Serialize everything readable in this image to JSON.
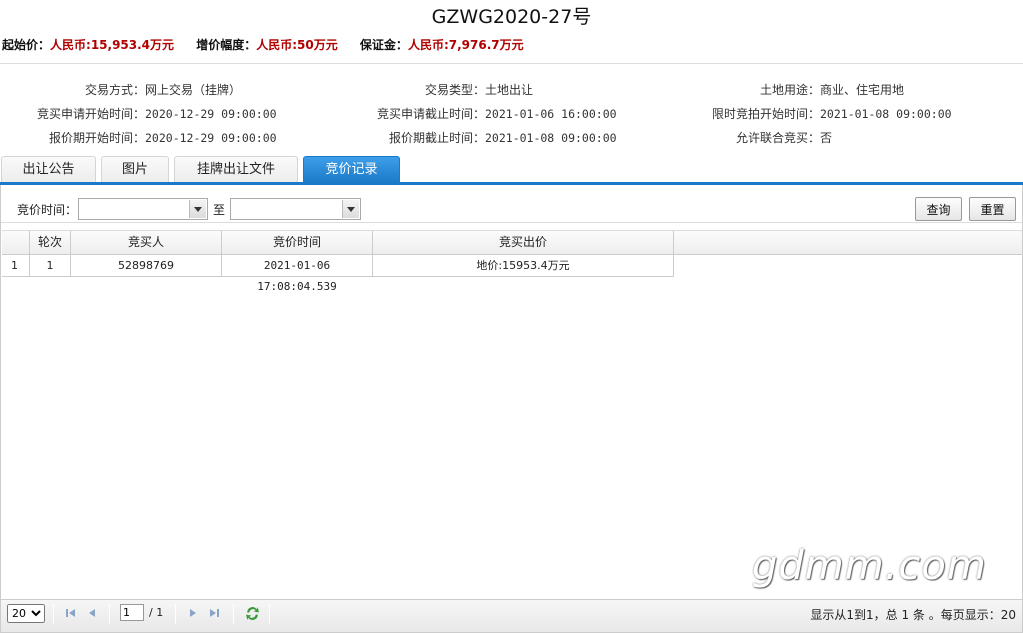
{
  "title": "GZWG2020-27号",
  "prices": {
    "start_label": "起始价：",
    "start_value": "人民币:15,953.4万元",
    "step_label": "增价幅度：",
    "step_value": "人民币:50万元",
    "deposit_label": "保证金：",
    "deposit_value": "人民币:7,976.7万元"
  },
  "info": {
    "col1": [
      {
        "k": "交易方式：",
        "v": "网上交易（挂牌）"
      },
      {
        "k": "竞买申请开始时间：",
        "v": "2020-12-29 09:00:00"
      },
      {
        "k": "报价期开始时间：",
        "v": "2020-12-29 09:00:00"
      }
    ],
    "col2": [
      {
        "k": "交易类型：",
        "v": "土地出让"
      },
      {
        "k": "竞买申请截止时间：",
        "v": "2021-01-06 16:00:00"
      },
      {
        "k": "报价期截止时间：",
        "v": "2021-01-08 09:00:00"
      }
    ],
    "col3": [
      {
        "k": "土地用途：",
        "v": "商业、住宅用地"
      },
      {
        "k": "限时竞拍开始时间：",
        "v": "2021-01-08 09:00:00"
      },
      {
        "k": "允许联合竞买：",
        "v": "否"
      }
    ]
  },
  "tabs": [
    "出让公告",
    "图片",
    "挂牌出让文件",
    "竞价记录"
  ],
  "active_tab": "竞价记录",
  "toolbar": {
    "time_label": "竞价时间：",
    "to_label": "至",
    "query_label": "查询",
    "reset_label": "重置"
  },
  "grid": {
    "headers": [
      "轮次",
      "竞买人",
      "竞价时间",
      "竞买出价"
    ],
    "rows": [
      {
        "num": "1",
        "round": "1",
        "bidder": "52898769",
        "time": "2021-01-06 17:08:04.539",
        "price": "地价:15953.4万元"
      }
    ]
  },
  "pager": {
    "page_size": "20",
    "page_value": "1",
    "total_pages": "/ 1",
    "summary": "显示从1到1，总 1 条 。每页显示：20"
  },
  "watermark": "gdmm.com"
}
